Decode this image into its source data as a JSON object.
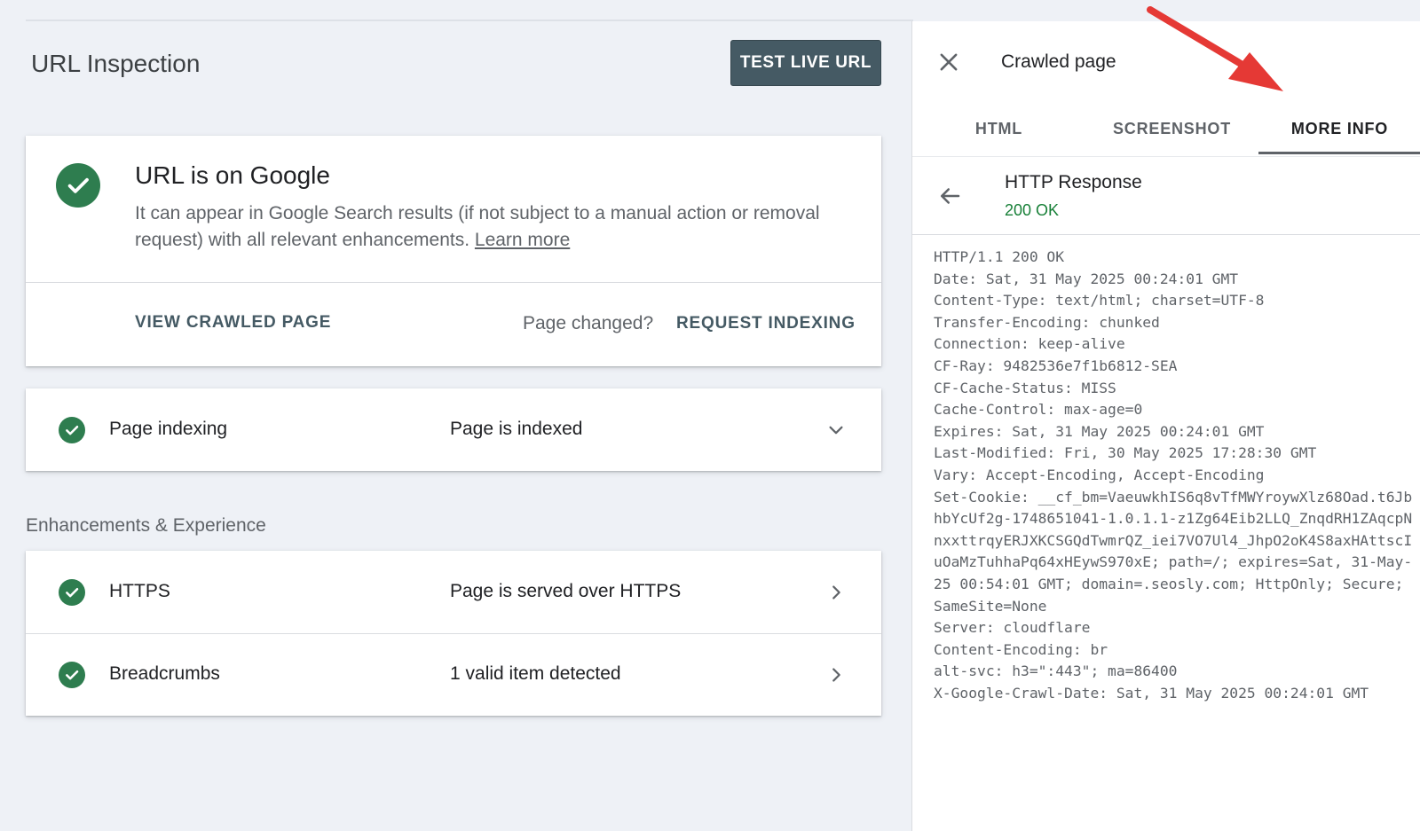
{
  "header": {
    "title": "URL Inspection",
    "test_live_url_label": "TEST LIVE URL"
  },
  "status_card": {
    "title": "URL is on Google",
    "description": "It can appear in Google Search results (if not subject to a manual action or removal request) with all relevant enhancements.",
    "learn_more": "Learn more",
    "view_crawled_label": "VIEW CRAWLED PAGE",
    "page_changed_label": "Page changed?",
    "request_indexing_label": "REQUEST INDEXING"
  },
  "indexing": {
    "name": "Page indexing",
    "status": "Page is indexed"
  },
  "enhancements": {
    "section_title": "Enhancements & Experience",
    "items": [
      {
        "name": "HTTPS",
        "status": "Page is served over HTTPS"
      },
      {
        "name": "Breadcrumbs",
        "status": "1 valid item detected"
      }
    ]
  },
  "panel": {
    "title": "Crawled page",
    "tabs": [
      "HTML",
      "SCREENSHOT",
      "MORE INFO"
    ],
    "active_tab": "MORE INFO",
    "response_title": "HTTP Response",
    "response_status": "200 OK",
    "headers": [
      "HTTP/1.1 200 OK",
      "Date: Sat, 31 May 2025 00:24:01 GMT",
      "Content-Type: text/html; charset=UTF-8",
      "Transfer-Encoding: chunked",
      "Connection: keep-alive",
      "CF-Ray: 9482536e7f1b6812-SEA",
      "CF-Cache-Status: MISS",
      "Cache-Control: max-age=0",
      "Expires: Sat, 31 May 2025 00:24:01 GMT",
      "Last-Modified: Fri, 30 May 2025 17:28:30 GMT",
      "Vary: Accept-Encoding, Accept-Encoding",
      "Set-Cookie: __cf_bm=VaeuwkhIS6q8vTfMWYroywXlz68Oad.t6JbhbYcUf2g-1748651041-1.0.1.1-z1Zg64Eib2LLQ_ZnqdRH1ZAqcpNnxxttrqyERJXKCSGQdTwmrQZ_iei7VO7Ul4_JhpO2oK4S8axHAttscIuOaMzTuhhaPq64xHEywS970xE; path=/; expires=Sat, 31-May-25 00:54:01 GMT; domain=.seosly.com; HttpOnly; Secure; SameSite=None",
      "Server: cloudflare",
      "Content-Encoding: br",
      "alt-svc: h3=\":443\"; ma=86400",
      "X-Google-Crawl-Date: Sat, 31 May 2025 00:24:01 GMT"
    ]
  },
  "icons": {
    "check": "check-circle-icon",
    "chevron_down": "chevron-down-icon",
    "chevron_right": "chevron-right-icon",
    "close": "close-icon",
    "back": "arrow-back-icon"
  },
  "colors": {
    "accent_button": "#455a64",
    "success_green": "#2e7d4f",
    "ok_text": "#188038",
    "annotation_arrow": "#e53935"
  }
}
